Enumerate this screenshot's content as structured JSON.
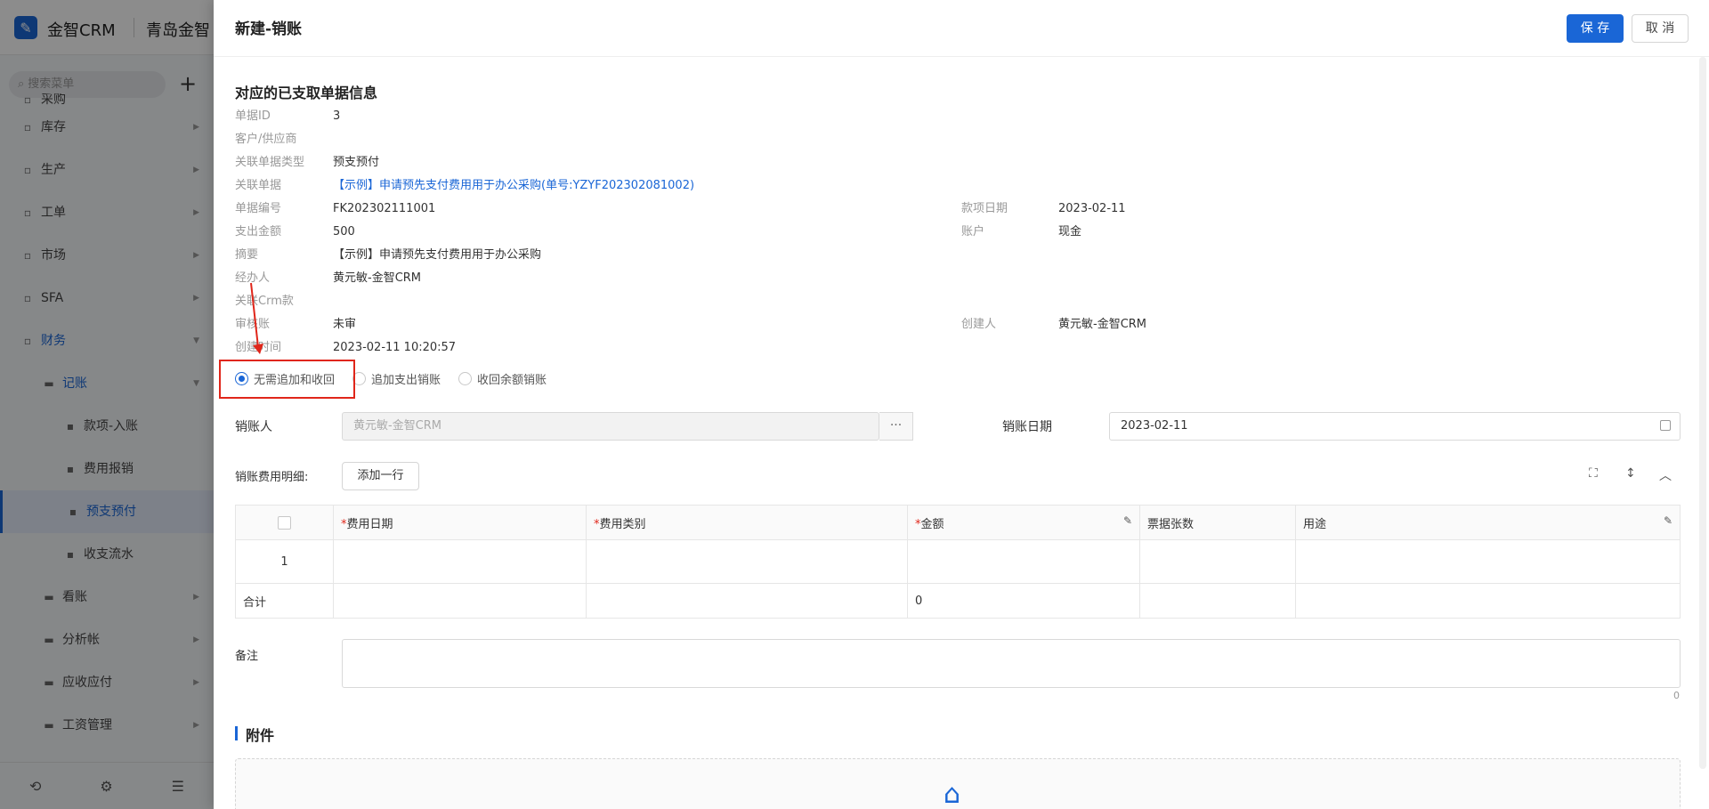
{
  "app": {
    "title": "金智CRM",
    "company": "青岛金智",
    "logo_icon": "logo-icon"
  },
  "sidebar": {
    "search_placeholder": "搜索菜单",
    "items": [
      {
        "label": "采购",
        "icon": "cart-icon"
      },
      {
        "label": "库存",
        "icon": "warehouse-icon"
      },
      {
        "label": "生产",
        "icon": "factory-icon"
      },
      {
        "label": "工单",
        "icon": "ticket-icon"
      },
      {
        "label": "市场",
        "icon": "market-icon"
      },
      {
        "label": "SFA",
        "icon": "sfa-icon"
      },
      {
        "label": "财务",
        "icon": "finance-icon"
      },
      {
        "label": "记账",
        "icon": "folder-icon"
      },
      {
        "label": "款项-入账",
        "icon": "money-in-icon"
      },
      {
        "label": "费用报销",
        "icon": "card-icon"
      },
      {
        "label": "预支预付",
        "icon": "wallet-icon"
      },
      {
        "label": "收支流水",
        "icon": "flow-icon"
      },
      {
        "label": "看账",
        "icon": "folder-icon"
      },
      {
        "label": "分析帐",
        "icon": "folder-icon"
      },
      {
        "label": "应收应付",
        "icon": "folder-icon"
      },
      {
        "label": "工资管理",
        "icon": "folder-icon"
      }
    ],
    "footer_icons": [
      "history-icon",
      "settings-icon",
      "collapse-icon"
    ]
  },
  "drawer": {
    "title": "新建-销账",
    "save_label": "保 存",
    "cancel_label": "取 消",
    "section_title": "对应的已支取单据信息",
    "info_left": [
      {
        "k": "单据ID",
        "v": "3"
      },
      {
        "k": "客户/供应商",
        "v": ""
      },
      {
        "k": "关联单据类型",
        "v": "预支预付"
      },
      {
        "k": "关联单据",
        "v": "【示例】申请预先支付费用用于办公采购(单号:YZYF202302081002)"
      },
      {
        "k": "单据编号",
        "v": "FK202302111001"
      },
      {
        "k": "支出金额",
        "v": "500"
      },
      {
        "k": "摘要",
        "v": "【示例】申请预先支付费用用于办公采购"
      },
      {
        "k": "经办人",
        "v": "黄元敏-金智CRM"
      },
      {
        "k": "关联Crm款",
        "v": ""
      },
      {
        "k": "审核账",
        "v": "未审"
      },
      {
        "k": "创建时间",
        "v": "2023-02-11 10:20:57"
      }
    ],
    "info_right": [
      {
        "k": "款项日期",
        "v": "2023-02-11"
      },
      {
        "k": "账户",
        "v": "现金"
      },
      {
        "k": "创建人",
        "v": "黄元敏-金智CRM"
      }
    ],
    "radios": [
      {
        "label": "无需追加和收回",
        "checked": true
      },
      {
        "label": "追加支出销账",
        "checked": false
      },
      {
        "label": "收回余额销账",
        "checked": false
      }
    ],
    "writer_label": "销账人",
    "writer_value": "黄元敏-金智CRM",
    "date_label": "销账日期",
    "date_value": "2023-02-11",
    "detail_label": "销账费用明细:",
    "add_row_label": "添加一行",
    "table": {
      "required_mark": "*",
      "headers": [
        "费用日期",
        "费用类别",
        "金额",
        "票据张数",
        "用途"
      ],
      "rows": [
        {
          "index": "1"
        }
      ],
      "total_label": "合计",
      "total_amount": "0"
    },
    "memo_label": "备注",
    "memo_count": "0",
    "attachment_title": "附件"
  }
}
